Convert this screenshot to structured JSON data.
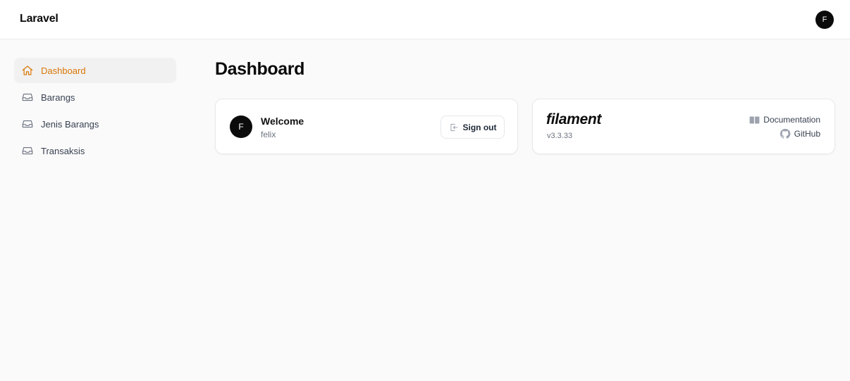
{
  "header": {
    "brand": "Laravel",
    "user_initial": "F"
  },
  "sidebar": {
    "items": [
      {
        "label": "Dashboard",
        "icon": "home-icon",
        "active": true
      },
      {
        "label": "Barangs",
        "icon": "inbox-icon",
        "active": false
      },
      {
        "label": "Jenis Barangs",
        "icon": "inbox-icon",
        "active": false
      },
      {
        "label": "Transaksis",
        "icon": "inbox-icon",
        "active": false
      }
    ]
  },
  "main": {
    "title": "Dashboard",
    "welcome_card": {
      "avatar_initial": "F",
      "title": "Welcome",
      "username": "felix",
      "signout_label": "Sign out"
    },
    "filament_card": {
      "logo": "filament",
      "version": "v3.3.33",
      "documentation_label": "Documentation",
      "github_label": "GitHub"
    }
  },
  "colors": {
    "accent": "#d97706",
    "background": "#fafafa",
    "surface": "#ffffff"
  }
}
